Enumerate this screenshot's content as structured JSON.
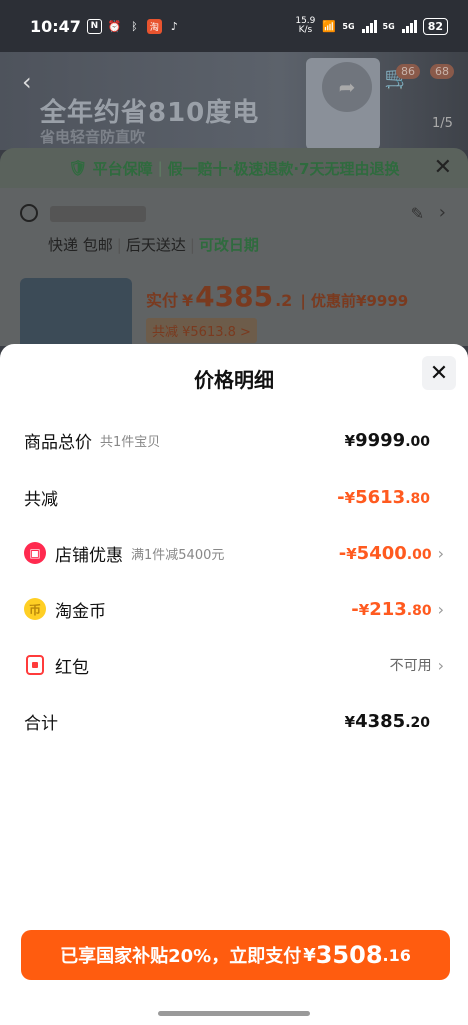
{
  "status_bar": {
    "time": "10:47",
    "net_speed_value": "15.9",
    "net_speed_unit": "K/s",
    "network_tag_1": "5G",
    "network_tag_2": "5G",
    "battery": "82"
  },
  "background": {
    "ad_line1": "全年约省810度电",
    "ad_line2": "省电轻音防直吹",
    "cart_badge_1": "86",
    "cart_badge_2": "68",
    "pager": "1/5",
    "guarantee": {
      "item1": "平台保障",
      "item2": "假一赔十·极速退款·7天无理由退换"
    },
    "delivery": {
      "express": "快递 包邮",
      "arrival": "后天送达",
      "change_date": "可改日期"
    },
    "product": {
      "paid_label": "实付",
      "currency": "¥",
      "paid_int": "4385",
      "paid_dec": ".2",
      "orig_label": "优惠前",
      "orig_price": "¥9999",
      "reduce_text": "共减 ¥5613.8 >"
    }
  },
  "sheet": {
    "title": "价格明细",
    "rows": [
      {
        "label": "商品总价",
        "sub": "共1件宝贝",
        "currency": "¥",
        "int": "9999",
        "dec": ".00"
      },
      {
        "label": "共减",
        "sign": "-",
        "currency": "¥",
        "int": "5613",
        "dec": ".80"
      },
      {
        "label": "店铺优惠",
        "sub": "满1件减5400元",
        "sign": "-",
        "currency": "¥",
        "int": "5400",
        "dec": ".00"
      },
      {
        "label": "淘金币",
        "sign": "-",
        "currency": "¥",
        "int": "213",
        "dec": ".80"
      },
      {
        "label": "红包",
        "status": "不可用"
      },
      {
        "label": "合计",
        "currency": "¥",
        "int": "4385",
        "dec": ".20"
      }
    ],
    "pay_button": {
      "text": "已享国家补贴20%，立即支付",
      "currency": "¥",
      "int": "3508",
      "dec": ".16"
    }
  },
  "colors": {
    "accent_orange": "#ff5a1f",
    "button_orange": "#ff5c0f",
    "guarantee_green": "#2f6b3e"
  },
  "icons": [
    "shield-icon",
    "close-icon",
    "location-pin-icon",
    "edit-icon",
    "chevron-right-icon",
    "shop-icon",
    "coin-icon",
    "red-packet-icon",
    "back-arrow-icon",
    "share-icon",
    "cart-icon"
  ]
}
